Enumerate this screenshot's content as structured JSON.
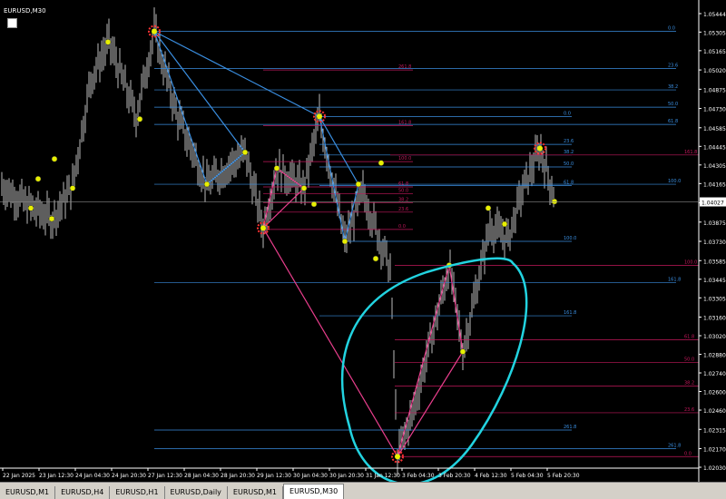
{
  "window": {
    "title": "EURUSD,M30"
  },
  "tabs": [
    {
      "label": "EURUSD,M1",
      "active": false
    },
    {
      "label": "EURUSD,H4",
      "active": false
    },
    {
      "label": "EURUSD,H1",
      "active": false
    },
    {
      "label": "EURUSD,Daily",
      "active": false
    },
    {
      "label": "EURUSD,M1",
      "active": false
    },
    {
      "label": "EURUSD,M30",
      "active": true
    }
  ],
  "colors": {
    "background": "#000000",
    "price_text": "#ffffff",
    "grid_blue": "#3a8ee0",
    "fib_pink": "#c2185b",
    "fib_red": "#ff3333",
    "highlight_cyan": "#22d3e0",
    "marker_yellow": "#e8f000",
    "candle": "#bdbdbd"
  },
  "chart_data": {
    "type": "line",
    "symbol": "EURUSD",
    "timeframe": "M30",
    "current_price": "1.04027",
    "y_ticks": [
      "1.05444",
      "1.05305",
      "1.05165",
      "1.05020",
      "1.04875",
      "1.04730",
      "1.04585",
      "1.04445",
      "1.04305",
      "1.04165",
      "1.04020",
      "1.03875",
      "1.03730",
      "1.03585",
      "1.03445",
      "1.03305",
      "1.03160",
      "1.03020",
      "1.02880",
      "1.02740",
      "1.02600",
      "1.02460",
      "1.02315",
      "1.02170",
      "1.02030"
    ],
    "x_ticks": [
      "22 Jan 2025",
      "23 Jan 12:30",
      "24 Jan 04:30",
      "24 Jan 20:30",
      "27 Jan 12:30",
      "28 Jan 04:30",
      "28 Jan 20:30",
      "29 Jan 12:30",
      "30 Jan 04:30",
      "30 Jan 20:30",
      "31 Jan 12:30",
      "3 Feb 04:30",
      "3 Feb 20:30",
      "4 Feb 12:30",
      "5 Feb 04:30",
      "5 Feb 20:30"
    ],
    "blue_levels": [
      {
        "label": "0.0",
        "price": 1.0531
      },
      {
        "label": "23.6",
        "price": 1.0503
      },
      {
        "label": "38.2",
        "price": 1.0487
      },
      {
        "label": "50.0",
        "price": 1.0474
      },
      {
        "label": "61.8",
        "price": 1.0461
      },
      {
        "label": "0.0",
        "price": 1.0467
      },
      {
        "label": "23.6",
        "price": 1.0446
      },
      {
        "label": "38.2",
        "price": 1.0438
      },
      {
        "label": "50.0",
        "price": 1.0429
      },
      {
        "label": "61.8",
        "price": 1.0415
      },
      {
        "label": "100.0",
        "price": 1.0416
      },
      {
        "label": "100.0",
        "price": 1.0373
      },
      {
        "label": "161.8",
        "price": 1.0342
      },
      {
        "label": "161.8",
        "price": 1.0317
      },
      {
        "label": "261.8",
        "price": 1.0231
      },
      {
        "label": "261.8",
        "price": 1.0217
      }
    ],
    "pink_levels": [
      {
        "label": "261.8",
        "price": 1.0502
      },
      {
        "label": "161.8",
        "price": 1.046
      },
      {
        "label": "100.0",
        "price": 1.0433
      },
      {
        "label": "61.8",
        "price": 1.0414
      },
      {
        "label": "50.0",
        "price": 1.0409
      },
      {
        "label": "38.2",
        "price": 1.0402
      },
      {
        "label": "23.6",
        "price": 1.0395
      },
      {
        "label": "0.0",
        "price": 1.0382
      },
      {
        "label": "161.8",
        "price": 1.0438
      },
      {
        "label": "100.0",
        "price": 1.0355
      },
      {
        "label": "61.8",
        "price": 1.0299
      },
      {
        "label": "50.0",
        "price": 1.0282
      },
      {
        "label": "38.2",
        "price": 1.0264
      },
      {
        "label": "23.6",
        "price": 1.0244
      },
      {
        "label": "0.0",
        "price": 1.0211
      }
    ]
  }
}
